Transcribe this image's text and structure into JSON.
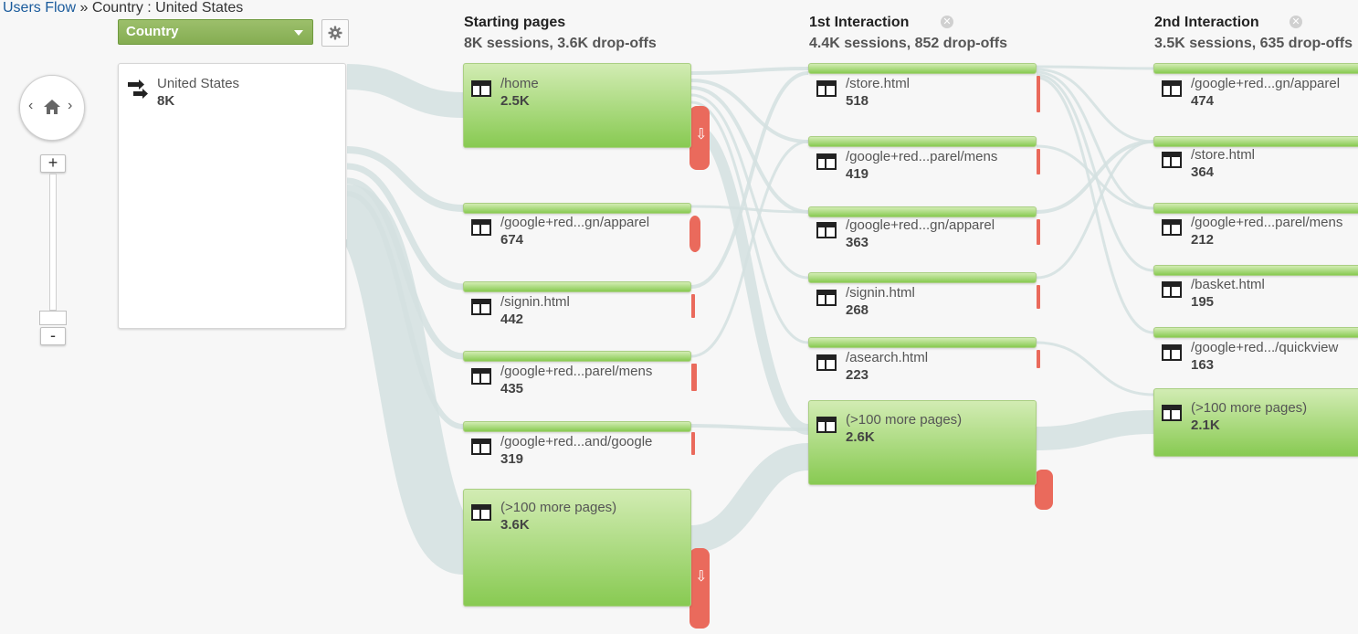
{
  "breadcrumb": {
    "link": "Users Flow",
    "separator": " » ",
    "current": "Country : United States"
  },
  "toolbar": {
    "dimension_select": "Country",
    "settings_icon": "gear-icon"
  },
  "navigation": {
    "left_arrow": "‹",
    "right_arrow": "›",
    "home_icon": "home-icon",
    "zoom_in": "+",
    "zoom_out": "-"
  },
  "source": {
    "label": "United States",
    "count": "8K",
    "icon": "traffic-arrows-icon"
  },
  "columns": [
    {
      "title": "Starting pages",
      "subtitle": "8K sessions, 3.6K drop-offs",
      "closable": false
    },
    {
      "title": "1st Interaction",
      "subtitle": "4.4K sessions, 852 drop-offs",
      "closable": true
    },
    {
      "title": "2nd Interaction",
      "subtitle": "3.5K sessions, 635 drop-offs",
      "closable": true
    }
  ],
  "nodes": [
    [
      {
        "label": "/home",
        "count": "2.5K"
      },
      {
        "label": "/google+red...gn/apparel",
        "count": "674"
      },
      {
        "label": "/signin.html",
        "count": "442"
      },
      {
        "label": "/google+red...parel/mens",
        "count": "435"
      },
      {
        "label": "/google+red...and/google",
        "count": "319"
      },
      {
        "label": "(>100 more pages)",
        "count": "3.6K"
      }
    ],
    [
      {
        "label": "/store.html",
        "count": "518"
      },
      {
        "label": "/google+red...parel/mens",
        "count": "419"
      },
      {
        "label": "/google+red...gn/apparel",
        "count": "363"
      },
      {
        "label": "/signin.html",
        "count": "268"
      },
      {
        "label": "/asearch.html",
        "count": "223"
      },
      {
        "label": "(>100 more pages)",
        "count": "2.6K"
      }
    ],
    [
      {
        "label": "/google+red...gn/apparel",
        "count": "474"
      },
      {
        "label": "/store.html",
        "count": "364"
      },
      {
        "label": "/google+red...parel/mens",
        "count": "212"
      },
      {
        "label": "/basket.html",
        "count": "195"
      },
      {
        "label": "/google+red.../quickview",
        "count": "163"
      },
      {
        "label": "(>100 more pages)",
        "count": "2.1K"
      }
    ]
  ],
  "colors": {
    "node_green": "#88ca52",
    "dropoff_red": "#ea6a5c",
    "flow": "#d4e0e0",
    "select_green": "#8fb55c"
  }
}
